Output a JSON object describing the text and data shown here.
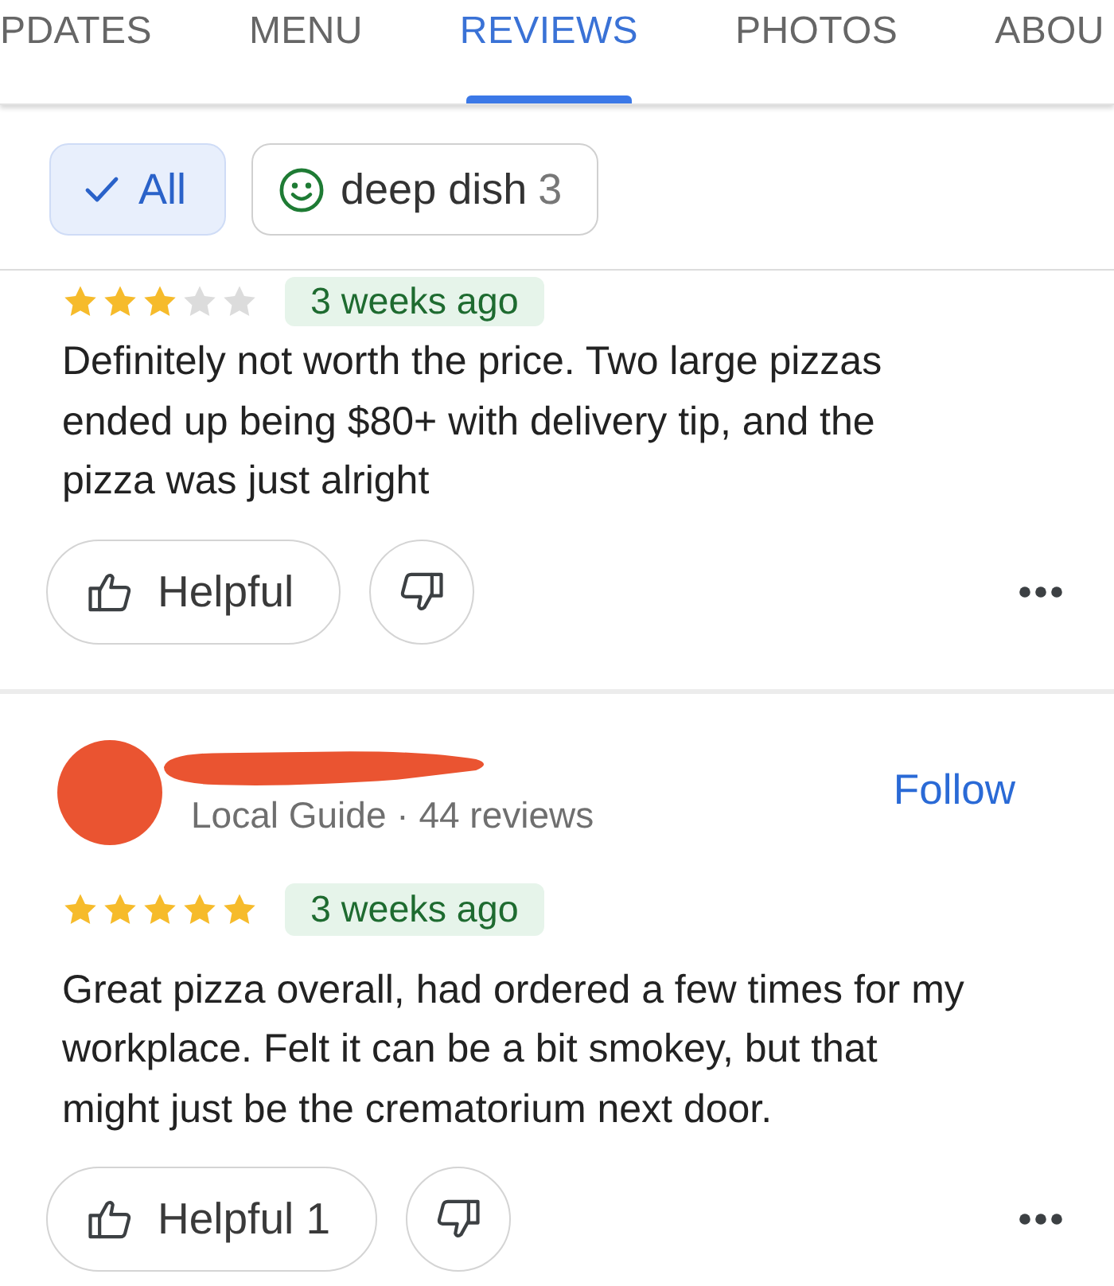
{
  "tabs": [
    {
      "label": "PDATES",
      "selected": false
    },
    {
      "label": "MENU",
      "selected": false
    },
    {
      "label": "REVIEWS",
      "selected": true
    },
    {
      "label": "PHOTOS",
      "selected": false
    },
    {
      "label": "ABOU",
      "selected": false
    }
  ],
  "filters": [
    {
      "kind": "all",
      "label": "All",
      "selected": true
    },
    {
      "kind": "topic",
      "label": "deep dish",
      "count": "3",
      "selected": false
    }
  ],
  "reviews": [
    {
      "stars": 3,
      "date": "3 weeks ago",
      "text": "Definitely not worth the price. Two large pizzas ended up being $80+ with delivery tip, and the pizza was just alright",
      "helpful": "Helpful"
    },
    {
      "author": {
        "meta": "Local Guide · 44 reviews",
        "follow": "Follow"
      },
      "stars": 5,
      "date": "3 weeks ago",
      "text": "Great pizza overall, had ordered a few times for my workplace. Felt it can be a bit smokey, but that might just be the crematorium next door.",
      "helpful": "Helpful 1"
    }
  ]
}
